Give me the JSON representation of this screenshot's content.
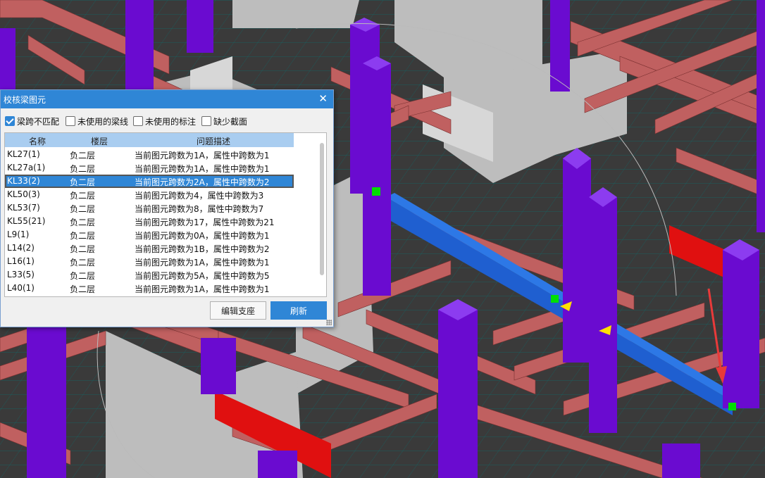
{
  "dialog": {
    "title": "校核梁图元",
    "close_icon": "close-icon",
    "options": [
      {
        "label": "梁跨不匹配",
        "checked": true
      },
      {
        "label": "未使用的梁线",
        "checked": false
      },
      {
        "label": "未使用的标注",
        "checked": false
      },
      {
        "label": "缺少截面",
        "checked": false
      }
    ],
    "columns": [
      "名称",
      "楼层",
      "问题描述"
    ],
    "rows": [
      {
        "name": "KL27(1)",
        "floor": "负二层",
        "desc": "当前图元跨数为1A，属性中跨数为1"
      },
      {
        "name": "KL27a(1)",
        "floor": "负二层",
        "desc": "当前图元跨数为1A，属性中跨数为1"
      },
      {
        "name": "KL33(2)",
        "floor": "负二层",
        "desc": "当前图元跨数为2A，属性中跨数为2"
      },
      {
        "name": "KL50(3)",
        "floor": "负二层",
        "desc": "当前图元跨数为4，属性中跨数为3"
      },
      {
        "name": "KL53(7)",
        "floor": "负二层",
        "desc": "当前图元跨数为8，属性中跨数为7"
      },
      {
        "name": "KL55(21)",
        "floor": "负二层",
        "desc": "当前图元跨数为17，属性中跨数为21"
      },
      {
        "name": "L9(1)",
        "floor": "负二层",
        "desc": "当前图元跨数为0A，属性中跨数为1"
      },
      {
        "name": "L14(2)",
        "floor": "负二层",
        "desc": "当前图元跨数为1B，属性中跨数为2"
      },
      {
        "name": "L16(1)",
        "floor": "负二层",
        "desc": "当前图元跨数为1A，属性中跨数为1"
      },
      {
        "name": "L33(5)",
        "floor": "负二层",
        "desc": "当前图元跨数为5A，属性中跨数为5"
      },
      {
        "name": "L40(1)",
        "floor": "负二层",
        "desc": "当前图元跨数为1A，属性中跨数为1"
      }
    ],
    "selected_row": 2,
    "buttons": {
      "edit_support": "编辑支座",
      "refresh": "刷新"
    }
  },
  "colors": {
    "accent": "#2f86d6",
    "beam": "#c06060",
    "column": "#6a0bd0",
    "highlight_beam": "#1f5fd0",
    "error_beam": "#e01010",
    "wall": "#bdbdbd",
    "marker": "#00e000",
    "arrow": "#e83a3a"
  }
}
